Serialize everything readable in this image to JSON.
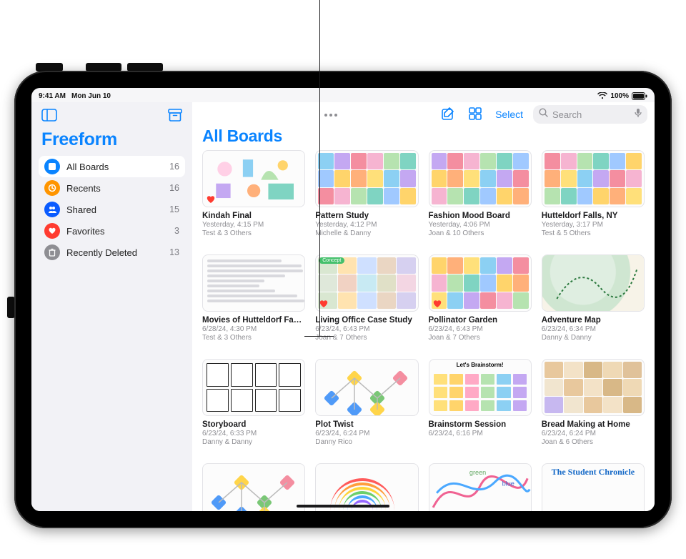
{
  "status": {
    "time": "9:41 AM",
    "date": "Mon Jun 10",
    "battery_pct": "100%"
  },
  "app_title": "Freeform",
  "sidebar": {
    "items": [
      {
        "label": "All Boards",
        "count": "16",
        "iconcls": "ic-blue",
        "name": "sidebar-item-all-boards",
        "selected": true
      },
      {
        "label": "Recents",
        "count": "16",
        "iconcls": "ic-orange",
        "name": "sidebar-item-recents"
      },
      {
        "label": "Shared",
        "count": "15",
        "iconcls": "ic-indigo",
        "name": "sidebar-item-shared"
      },
      {
        "label": "Favorites",
        "count": "3",
        "iconcls": "ic-red",
        "name": "sidebar-item-favorites"
      },
      {
        "label": "Recently Deleted",
        "count": "13",
        "iconcls": "ic-gray",
        "name": "sidebar-item-recently-deleted"
      }
    ]
  },
  "toolbar": {
    "select_label": "Select",
    "search_placeholder": "Search"
  },
  "main_title": "All Boards",
  "boards": [
    {
      "title": "Kindah Final",
      "date": "Yesterday, 4:15 PM",
      "share": "Test & 3 Others",
      "fav": true,
      "art": "doodle"
    },
    {
      "title": "Pattern Study",
      "date": "Yesterday, 4:12 PM",
      "share": "Michelle & Danny",
      "fav": false,
      "art": "pattern"
    },
    {
      "title": "Fashion Mood Board",
      "date": "Yesterday, 4:06 PM",
      "share": "Joan & 10 Others",
      "fav": false,
      "art": "fashion"
    },
    {
      "title": "Hutteldorf Falls, NY",
      "date": "Yesterday, 3:17 PM",
      "share": "Test & 5 Others",
      "fav": false,
      "art": "trip"
    },
    {
      "title": "Movies of Hutteldorf Fa…",
      "date": "6/28/24, 4:30 PM",
      "share": "Test & 3 Others",
      "fav": false,
      "art": "script"
    },
    {
      "title": "Living Office Case Study",
      "date": "6/23/24, 6:43 PM",
      "share": "Joan & 7 Others",
      "fav": true,
      "art": "office"
    },
    {
      "title": "Pollinator Garden",
      "date": "6/23/24, 6:43 PM",
      "share": "Joan & 7 Others",
      "fav": true,
      "art": "garden"
    },
    {
      "title": "Adventure Map",
      "date": "6/23/24, 6:34 PM",
      "share": "Danny & Danny",
      "fav": false,
      "art": "map"
    },
    {
      "title": "Storyboard",
      "date": "6/23/24, 6:33 PM",
      "share": "Danny & Danny",
      "fav": false,
      "art": "story"
    },
    {
      "title": "Plot Twist",
      "date": "6/23/24, 6:24 PM",
      "share": "Danny Rico",
      "fav": false,
      "art": "flow"
    },
    {
      "title": "Brainstorm Session",
      "date": "6/23/24, 6:16 PM",
      "share": "",
      "fav": false,
      "art": "stickies",
      "header": "Let's Brainstorm!"
    },
    {
      "title": "Bread Making at Home",
      "date": "6/23/24, 6:24 PM",
      "share": "Joan & 6 Others",
      "fav": false,
      "art": "bread"
    },
    {
      "title": "",
      "date": "",
      "share": "",
      "fav": false,
      "art": "flow2",
      "partial": true
    },
    {
      "title": "",
      "date": "",
      "share": "",
      "fav": false,
      "art": "rainbow",
      "partial": true
    },
    {
      "title": "",
      "date": "",
      "share": "",
      "fav": false,
      "art": "scribble",
      "partial": true
    },
    {
      "title": "",
      "date": "",
      "share": "",
      "fav": false,
      "art": "news",
      "header": "The Student Chronicle",
      "partial": true
    }
  ]
}
